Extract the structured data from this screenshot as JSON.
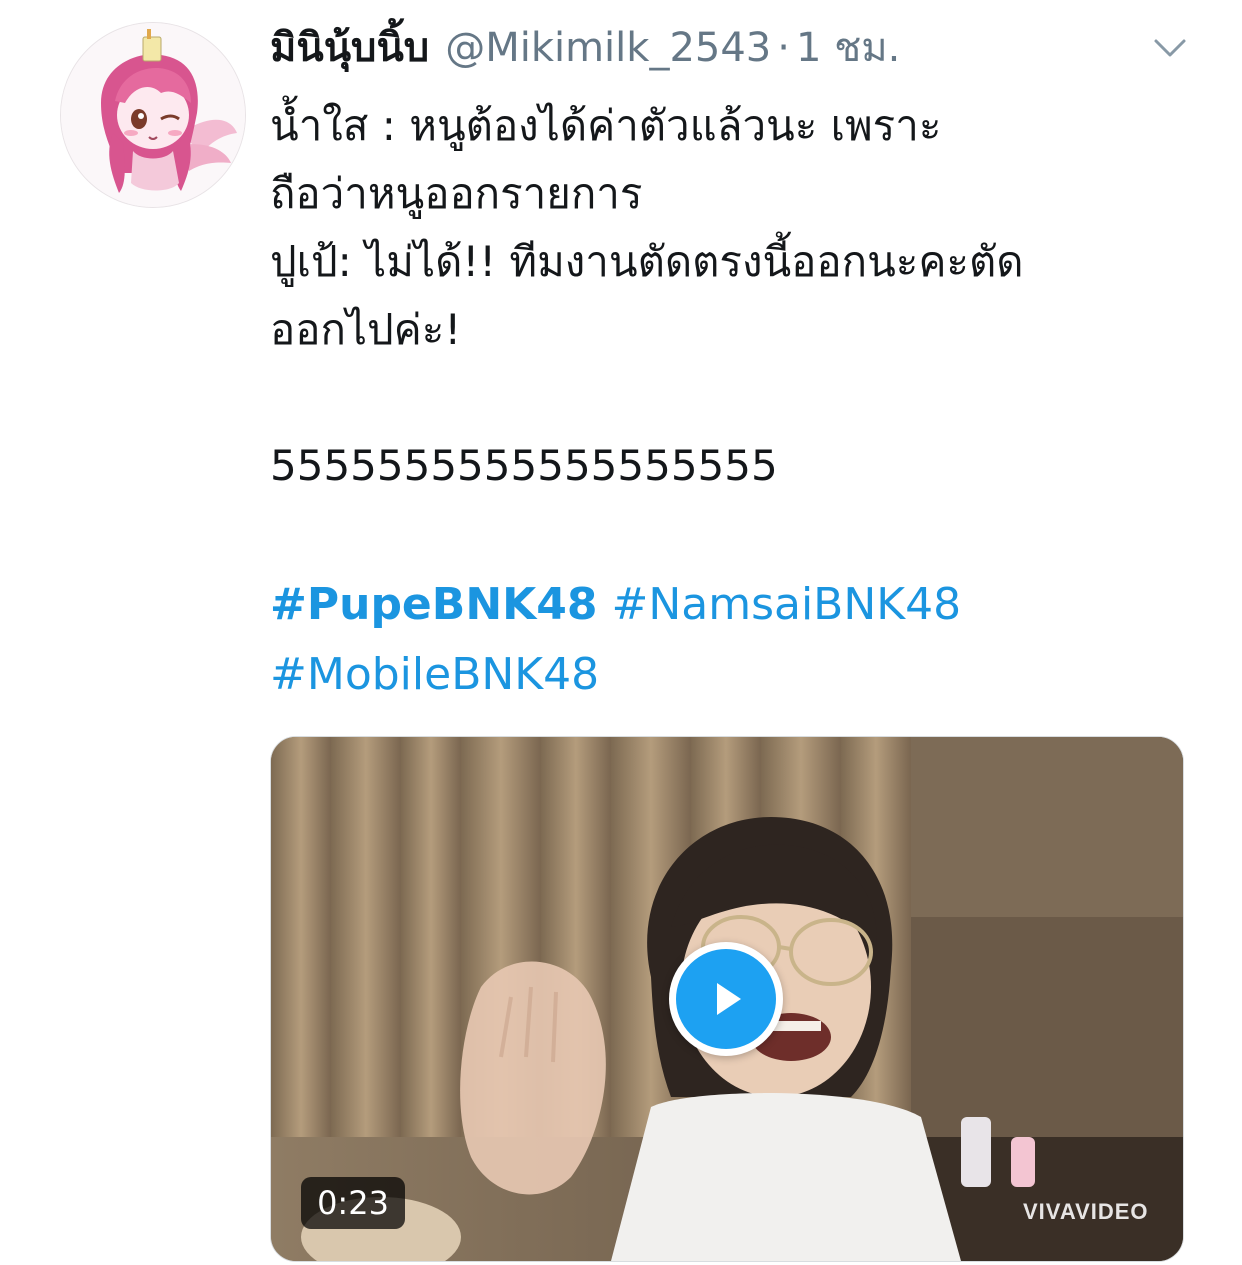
{
  "tweet": {
    "display_name": "มินินุุ้บนิ้บ",
    "handle": "@Mikimilk_2543",
    "separator": "·",
    "time": "1 ชม.",
    "text_lines": [
      "น้ำใส : หนูต้องได้ค่าตัวแล้วนะ เพราะ",
      "ถือว่าหนูออกรายการ",
      "ปูเป้: ไม่ได้!! ทีมงานตัดตรงนี้ออกนะคะตัด",
      "ออกไปค่ะ!",
      "",
      "5555555555555555555"
    ],
    "hashtags": {
      "row1": [
        "#PupeBNK48",
        "#NamsaiBNK48"
      ],
      "row2": [
        "#MobileBNK48"
      ]
    },
    "media": {
      "type": "video",
      "duration": "0:23",
      "watermark": "VIVAVIDEO"
    }
  },
  "icons": {
    "avatar": "pony-avatar-icon",
    "more": "chevron-down-icon",
    "play": "play-icon"
  },
  "colors": {
    "link": "#1b95e0",
    "secondary_text": "#657786",
    "primary_text": "#14171a",
    "play_button": "#1da1f2"
  }
}
